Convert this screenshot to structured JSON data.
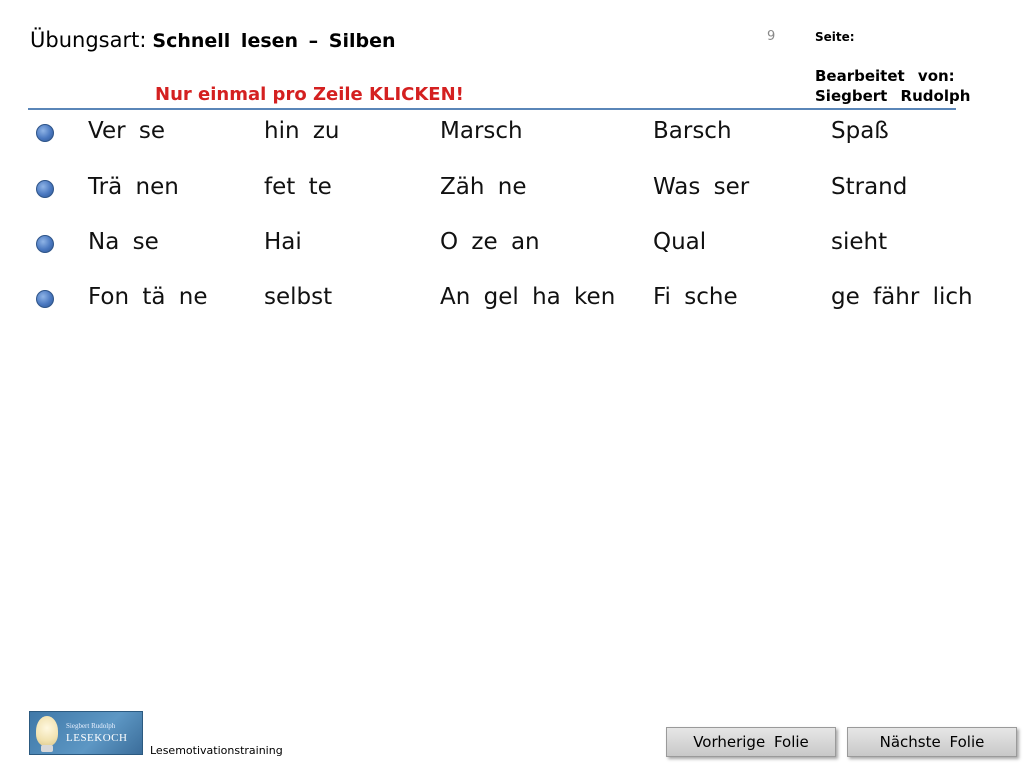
{
  "header": {
    "prefix": "Übungsart:",
    "title": "Schnell lesen – Silben",
    "page_number": "9",
    "page_label": "Seite:",
    "edited_by_line1": "Bearbeitet von:",
    "edited_by_line2": "Siegbert Rudolph",
    "instruction": "Nur einmal pro Zeile KLICKEN!",
    "accent_color": "#d42020",
    "divider_color": "#5a86b8"
  },
  "rows": [
    {
      "words": [
        "Ver se",
        "hin zu",
        "Marsch",
        "Barsch",
        "Spaß"
      ]
    },
    {
      "words": [
        "Trä nen",
        "fet te",
        "Zäh ne",
        "Was ser",
        "Strand"
      ]
    },
    {
      "words": [
        "Na se",
        "Hai",
        "O ze an",
        "Qual",
        "sieht"
      ]
    },
    {
      "words": [
        "Fon tä ne",
        "selbst",
        "An gel ha ken",
        "Fi sche",
        "ge fähr lich"
      ]
    }
  ],
  "footer": {
    "logo_name": "Siegbert Rudolph",
    "logo_brand": "LESEKOCH",
    "label": "Lesemotivationstraining",
    "prev_button": "Vorherige Folie",
    "next_button": "Nächste Folie"
  }
}
